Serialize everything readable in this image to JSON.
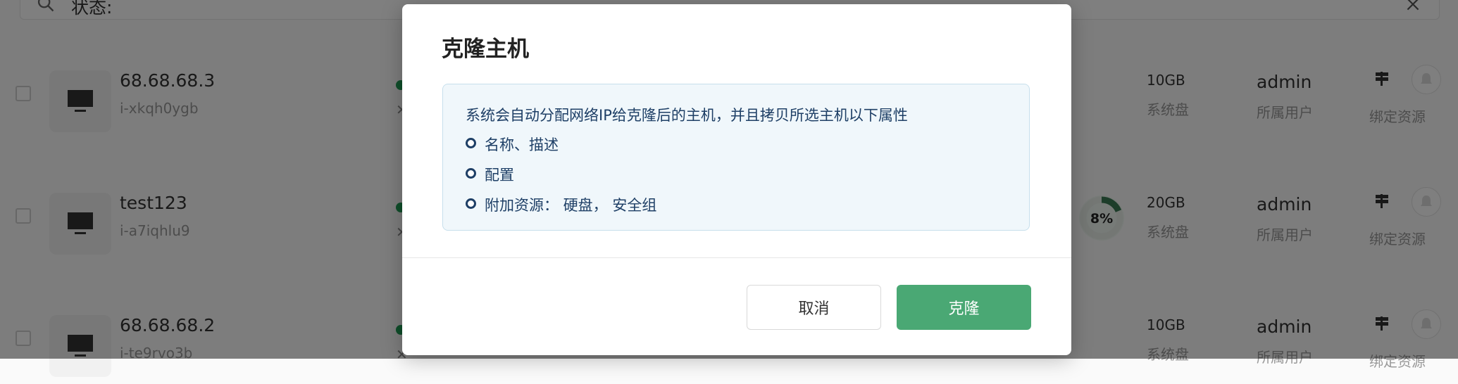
{
  "background": {
    "filter": {
      "label": "状态:"
    },
    "rows": [
      {
        "name": "68.68.68.3",
        "id": "i-xkqh0ygb",
        "status_mark": "✕",
        "size": "10GB",
        "size_label": "系统盘",
        "user": "admin",
        "user_label": "所属用户",
        "bind_label": "绑定资源",
        "cpu": ""
      },
      {
        "name": "test123",
        "id": "i-a7iqhlu9",
        "status_mark": "✕",
        "size": "20GB",
        "size_label": "系统盘",
        "user": "admin",
        "user_label": "所属用户",
        "bind_label": "绑定资源",
        "cpu": "8%"
      },
      {
        "name": "68.68.68.2",
        "id": "i-te9rvo3b",
        "status_mark": "✕",
        "size": "10GB",
        "size_label": "系统盘",
        "user": "admin",
        "user_label": "所属用户",
        "bind_label": "绑定资源",
        "cpu": ""
      }
    ]
  },
  "modal": {
    "title": "克隆主机",
    "info": {
      "heading": "系统会自动分配网络IP给克隆后的主机，并且拷贝所选主机以下属性",
      "items": [
        "名称、描述",
        "配置",
        "附加资源： 硬盘， 安全组"
      ]
    },
    "cancel_label": "取消",
    "confirm_label": "克隆"
  },
  "colors": {
    "primary": "#4aa874",
    "info_text": "#1e3f66",
    "info_bg": "#f0f7fb",
    "overlay": "rgba(0,0,0,0.5)"
  }
}
